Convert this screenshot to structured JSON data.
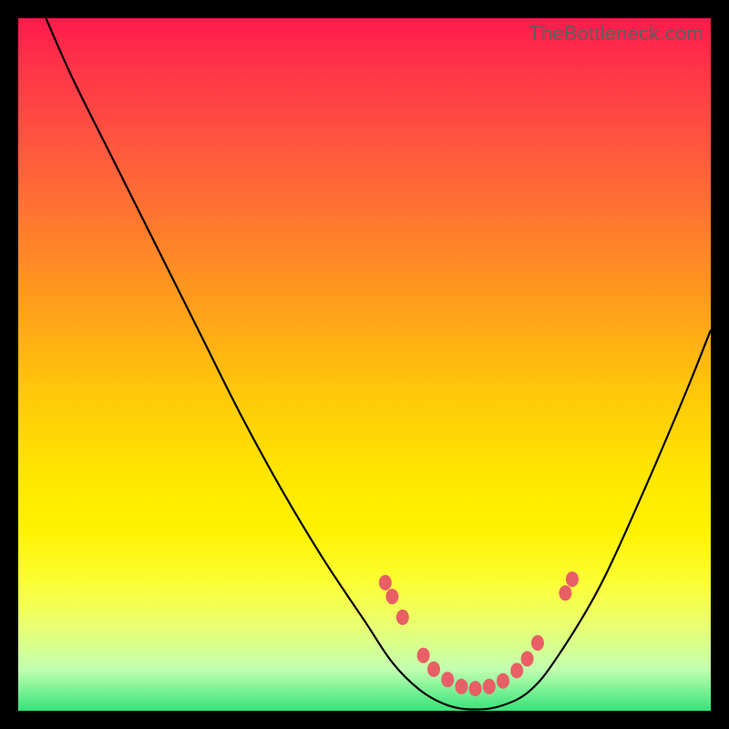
{
  "watermark": "TheBottleneck.com",
  "colors": {
    "dot": "#e85f65",
    "curve": "#000000",
    "frame_bg": "#000000",
    "gradient_top": "#ff1a4d",
    "gradient_bottom": "#36e37a"
  },
  "chart_data": {
    "type": "line",
    "title": "",
    "xlabel": "",
    "ylabel": "",
    "x_range": [
      0,
      100
    ],
    "y_range_percent_bottleneck": [
      0,
      100
    ],
    "note": "No axis ticks or numeric labels are rendered; values below are positional estimates read from the plotted curve, where y=100 is the top of the inner chart and y=0 is the bottom.",
    "curve_points": [
      {
        "x": 4.0,
        "y": 100.0
      },
      {
        "x": 8.0,
        "y": 91.0
      },
      {
        "x": 14.0,
        "y": 79.0
      },
      {
        "x": 20.0,
        "y": 67.0
      },
      {
        "x": 26.0,
        "y": 55.0
      },
      {
        "x": 32.0,
        "y": 43.0
      },
      {
        "x": 38.0,
        "y": 32.0
      },
      {
        "x": 44.0,
        "y": 22.0
      },
      {
        "x": 50.0,
        "y": 13.0
      },
      {
        "x": 54.0,
        "y": 7.0
      },
      {
        "x": 58.0,
        "y": 3.0
      },
      {
        "x": 62.0,
        "y": 0.8
      },
      {
        "x": 66.0,
        "y": 0.2
      },
      {
        "x": 70.0,
        "y": 0.8
      },
      {
        "x": 74.0,
        "y": 3.0
      },
      {
        "x": 78.0,
        "y": 8.0
      },
      {
        "x": 84.0,
        "y": 18.0
      },
      {
        "x": 90.0,
        "y": 31.0
      },
      {
        "x": 96.0,
        "y": 45.0
      },
      {
        "x": 100.0,
        "y": 55.0
      }
    ],
    "marker_points": [
      {
        "x": 53.0,
        "y": 18.5
      },
      {
        "x": 54.0,
        "y": 16.5
      },
      {
        "x": 55.5,
        "y": 13.5
      },
      {
        "x": 58.5,
        "y": 8.0
      },
      {
        "x": 60.0,
        "y": 6.0
      },
      {
        "x": 62.0,
        "y": 4.5
      },
      {
        "x": 64.0,
        "y": 3.5
      },
      {
        "x": 66.0,
        "y": 3.2
      },
      {
        "x": 68.0,
        "y": 3.5
      },
      {
        "x": 70.0,
        "y": 4.3
      },
      {
        "x": 72.0,
        "y": 5.8
      },
      {
        "x": 73.5,
        "y": 7.5
      },
      {
        "x": 75.0,
        "y": 9.8
      },
      {
        "x": 79.0,
        "y": 17.0
      },
      {
        "x": 80.0,
        "y": 19.0
      }
    ]
  }
}
